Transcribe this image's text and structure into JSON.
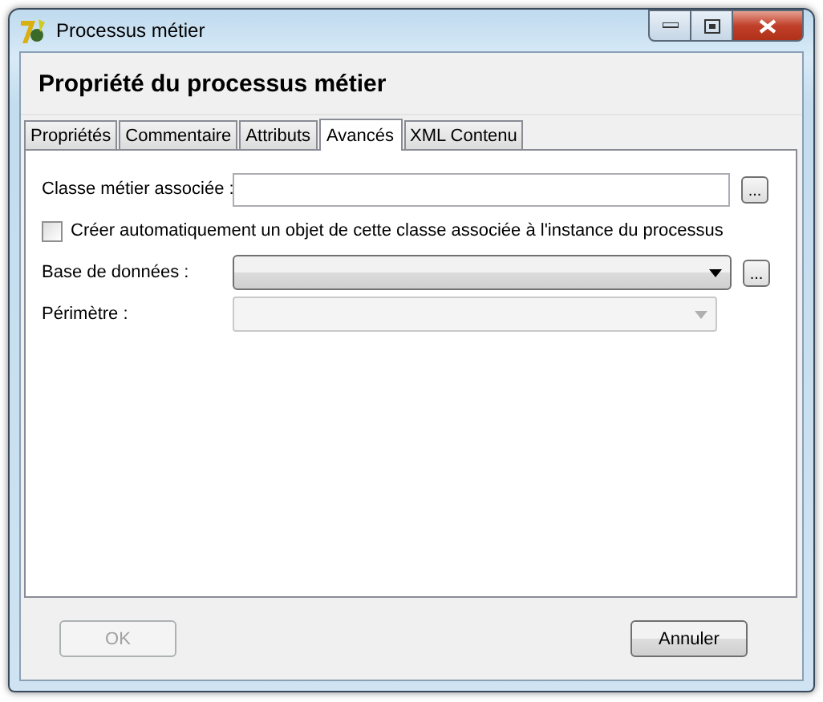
{
  "window": {
    "title": "Processus métier"
  },
  "header": "Propriété du processus métier",
  "tabs": [
    {
      "label": "Propriétés",
      "selected": false
    },
    {
      "label": "Commentaire",
      "selected": false
    },
    {
      "label": "Attributs",
      "selected": false
    },
    {
      "label": "Avancés",
      "selected": true
    },
    {
      "label": "XML Contenu",
      "selected": false
    }
  ],
  "fields": [
    {
      "kind": "text",
      "label": "Classe métier associée :",
      "browse": "..."
    },
    {
      "kind": "checkbox",
      "label": "Créer automatiquement un objet de cette classe associée à l'instance du processus",
      "checked": false
    },
    {
      "kind": "dropdown",
      "label": "Base de données :",
      "browse": "...",
      "disabled": false
    },
    {
      "kind": "dropdown",
      "label": "Périmètre :",
      "disabled": true
    }
  ],
  "buttons": [
    {
      "label": "OK",
      "disabled": true
    },
    {
      "label": "Annuler",
      "disabled": false
    }
  ]
}
